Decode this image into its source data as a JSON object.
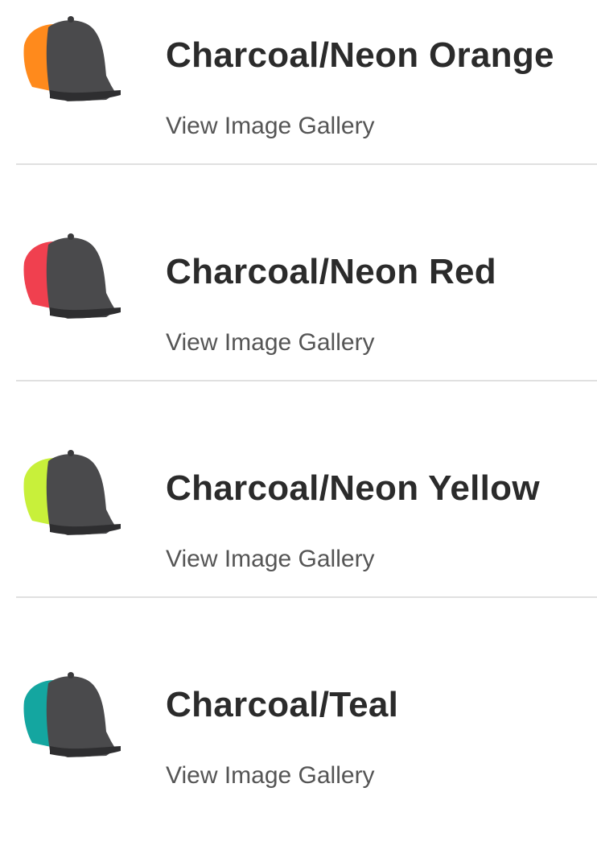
{
  "colors": {
    "title": "#2b2b2b",
    "link": "#555555",
    "divider": "#e0e0e0",
    "crown": "#4a4a4c"
  },
  "products": [
    {
      "name": "Charcoal/Neon Orange",
      "link_label": "View Image Gallery",
      "icon": "cap-icon",
      "mesh_color": "#ff8a1c"
    },
    {
      "name": "Charcoal/Neon Red",
      "link_label": "View Image Gallery",
      "icon": "cap-icon",
      "mesh_color": "#f0404f"
    },
    {
      "name": "Charcoal/Neon Yellow",
      "link_label": "View Image Gallery",
      "icon": "cap-icon",
      "mesh_color": "#c8f03a"
    },
    {
      "name": "Charcoal/Teal",
      "link_label": "View Image Gallery",
      "icon": "cap-icon",
      "mesh_color": "#14a6a0"
    }
  ]
}
